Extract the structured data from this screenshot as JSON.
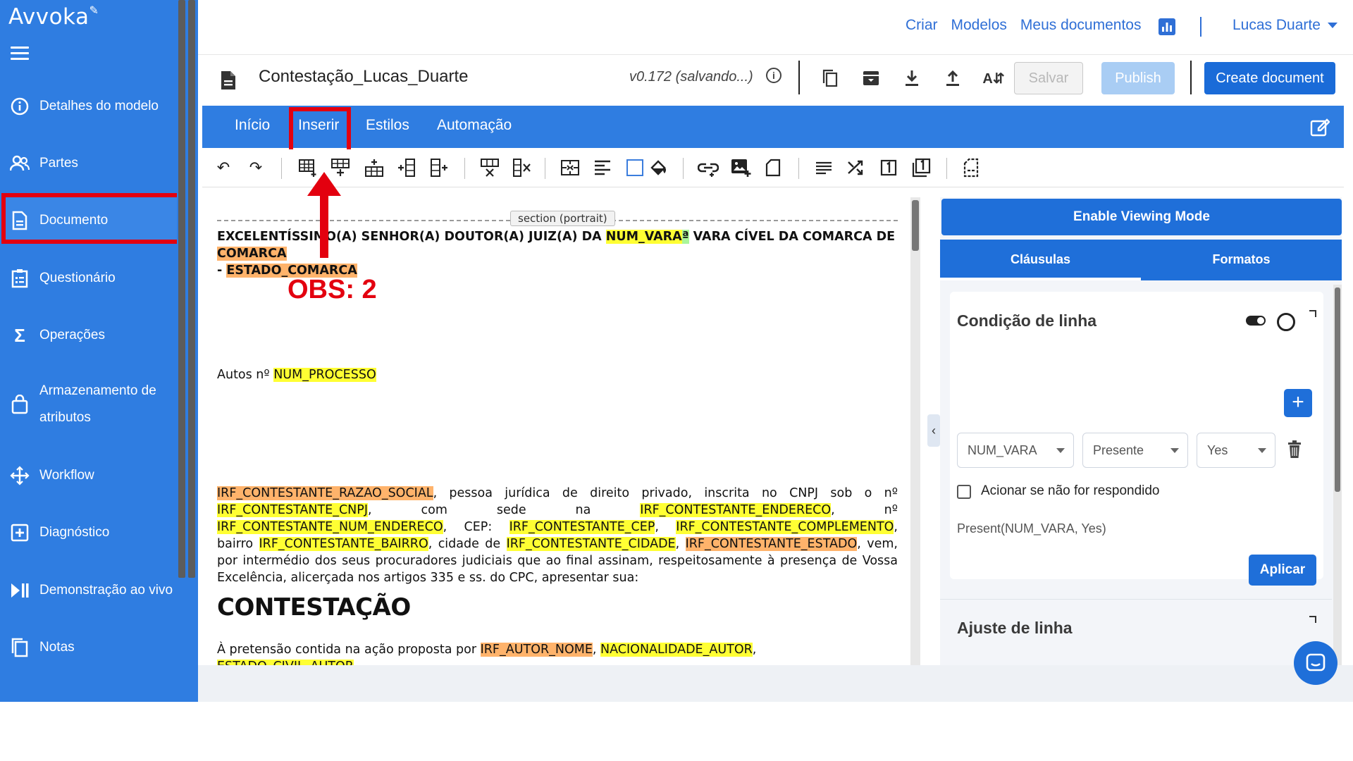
{
  "app": {
    "logo": "Avvoka"
  },
  "sidebar": {
    "items": [
      {
        "label": "Detalhes do modelo",
        "icon": "info-icon"
      },
      {
        "label": "Partes",
        "icon": "people-icon"
      },
      {
        "label": "Documento",
        "icon": "document-icon",
        "active": true
      },
      {
        "label": "Questionário",
        "icon": "clipboard-icon"
      },
      {
        "label": "Operações",
        "icon": "sigma-icon"
      },
      {
        "label": "Armazenamento de",
        "label2": "atributos",
        "icon": "bag-icon"
      },
      {
        "label": "Workflow",
        "icon": "workflow-icon"
      },
      {
        "label": "Diagnóstico",
        "icon": "plus-box-icon"
      },
      {
        "label": "Demonstração ao vivo",
        "icon": "play-pause-icon"
      },
      {
        "label": "Notas",
        "icon": "copy-icon"
      }
    ]
  },
  "header": {
    "links": [
      "Criar",
      "Modelos",
      "Meus documentos"
    ],
    "user": "Lucas Duarte"
  },
  "document": {
    "title": "Contestação_Lucas_Duarte",
    "version": "v0.172 (salvando...)",
    "buttons": {
      "save": "Salvar",
      "publish": "Publish",
      "create": "Create document"
    }
  },
  "ribbon": {
    "tabs": [
      "Início",
      "Inserir",
      "Estilos",
      "Automação"
    ]
  },
  "annotation": {
    "obs": "OBS: 2"
  },
  "doc_content": {
    "section_tag": "section (portrait)",
    "p1_a": "EXCELENTÍSSIMO(A) SENHOR(A) DOUTOR(A) JUIZ(A) DA ",
    "p1_var1": "NUM_VARA",
    "p1_sup": "ª",
    "p1_b": " VARA CÍVEL DA COMARCA DE ",
    "p1_var2": "COMARCA",
    "p1_c": " - ",
    "p1_var3": "ESTADO_COMARCA",
    "autos_label": "Autos nº ",
    "autos_var": "NUM_PROCESSO",
    "p3": {
      "v1": "IRF_CONTESTANTE_RAZAO_SOCIAL",
      "t1": ", pessoa jurídica de direito privado, inscrita no CNPJ sob o nº ",
      "v2": "IRF_CONTESTANTE_CNPJ",
      "t2": ", com sede na ",
      "v3": "IRF_CONTESTANTE_ENDERECO",
      "t3": ", nº ",
      "v4": "IRF_CONTESTANTE_NUM_ENDERECO",
      "t4": ", CEP: ",
      "v5": "IRF_CONTESTANTE_CEP",
      "t5": ", ",
      "v6": "IRF_CONTESTANTE_COMPLEMENTO",
      "t6": ", bairro ",
      "v7": "IRF_CONTESTANTE_BAIRRO",
      "t7": ", cidade de ",
      "v8": "IRF_CONTESTANTE_CIDADE",
      "t8": ", ",
      "v9": "IRF_CONTESTANTE_ESTADO",
      "t9": ", vem, por intermédio dos seus procuradores judiciais que ao final assinam, respeitosamente à presença de Vossa Excelência, alicerçada nos artigos 335 e ss. do CPC, apresentar sua:"
    },
    "heading": "CONTESTAÇÃO",
    "p4": {
      "t1": "À pretensão contida na ação proposta por ",
      "v1": "IRF_AUTOR_NOME",
      "t2": ", ",
      "v2": "NACIONALIDADE_AUTOR",
      "t3": ", ",
      "v3": "ESTADO_CIVIL_AUTOR",
      "t4": ","
    }
  },
  "right_panel": {
    "viewing_button": "Enable Viewing Mode",
    "tabs": [
      "Cláusulas",
      "Formatos"
    ],
    "card_title": "Condição de linha",
    "condition": {
      "field": "NUM_VARA",
      "operator": "Presente",
      "value": "Yes"
    },
    "checkbox_label": "Acionar se não for respondido",
    "expression": "Present(NUM_VARA, Yes)",
    "apply_button": "Aplicar",
    "card2_title": "Ajuste de linha"
  },
  "colors": {
    "brand_blue": "#2f7de1",
    "annotation_red": "#e3000f",
    "highlight_yellow": "#ffff33",
    "highlight_orange": "#ffb36b",
    "highlight_green": "#aaf59b"
  }
}
